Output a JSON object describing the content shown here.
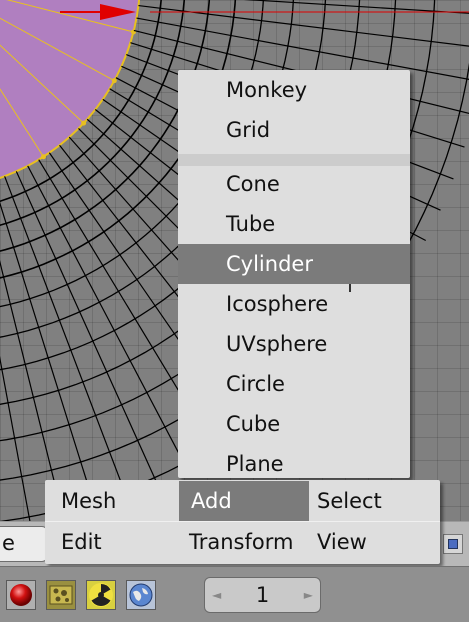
{
  "add_submenu": {
    "group1": [
      "Monkey",
      "Grid"
    ],
    "group2": [
      "Cone",
      "Tube",
      "Cylinder",
      "Icosphere",
      "UVsphere",
      "Circle",
      "Cube",
      "Plane"
    ],
    "highlighted": "Cylinder"
  },
  "mesh_menu": {
    "row1": [
      "Mesh",
      "Add",
      "Select"
    ],
    "row2": [
      "Edit",
      "Transform",
      "View"
    ],
    "highlighted": "Add"
  },
  "header": {
    "left_label": "e"
  },
  "timeline": {
    "frame_value": "1",
    "prev_arrow": "◄",
    "next_arrow": "►"
  },
  "colors": {
    "viewport": "#808080",
    "selected_face": "#b07fc0",
    "menu_bg": "#dedede",
    "menu_highlight": "#7b7b7b",
    "edge_select": "#e8c020",
    "axis_red": "#e00000"
  },
  "icons": [
    "record-icon",
    "texture-icon",
    "radioactive-icon",
    "globe-icon"
  ]
}
